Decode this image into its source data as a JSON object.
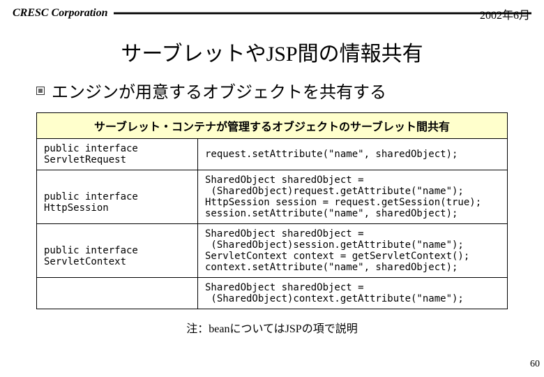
{
  "header": {
    "corp": "CRESC Corporation",
    "date": "2002年6月"
  },
  "title": "サーブレットやJSP間の情報共有",
  "subtitle": "エンジンが用意するオブジェクトを共有する",
  "box": {
    "header": "サーブレット・コンテナが管理するオブジェクトのサーブレット間共有",
    "rows": [
      {
        "left": "public interface\nServletRequest",
        "right": "request.setAttribute(\"name\", sharedObject);"
      },
      {
        "left": "\npublic interface\nHttpSession",
        "right": "SharedObject sharedObject =\n (SharedObject)request.getAttribute(\"name\");\nHttpSession session = request.getSession(true);\nsession.setAttribute(\"name\", sharedObject);"
      },
      {
        "left": "\npublic interface\nServletContext",
        "right": "SharedObject sharedObject =\n (SharedObject)session.getAttribute(\"name\");\nServletContext context = getServletContext();\ncontext.setAttribute(\"name\", sharedObject);"
      },
      {
        "left": "",
        "right": "SharedObject sharedObject =\n (SharedObject)context.getAttribute(\"name\");"
      }
    ]
  },
  "note": {
    "prefix": "注：",
    "bean": "bean",
    "suffix": "についてはJSPの項で説明"
  },
  "pagenum": "60"
}
